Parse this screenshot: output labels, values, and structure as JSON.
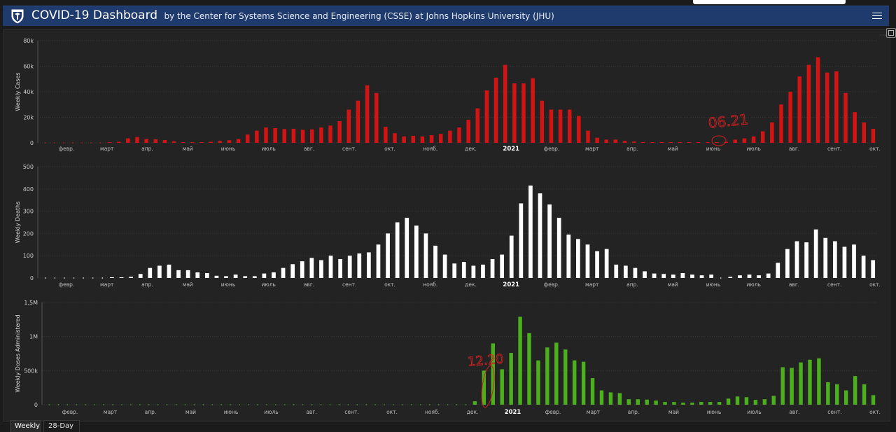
{
  "header": {
    "title": "COVID-19 Dashboard",
    "subtitle": "by the Center for Systems Science and Engineering (CSSE) at Johns Hopkins University (JHU)"
  },
  "tabs": [
    "Weekly",
    "28-Day"
  ],
  "colors": {
    "cases": "#d31414",
    "deaths": "#ffffff",
    "doses": "#4caf1d",
    "annotation": "#d32020"
  },
  "annotations": {
    "cases_note": "06.21",
    "doses_note": "12.20"
  },
  "chart_data": [
    {
      "type": "bar",
      "ylabel": "Weekly Cases",
      "ylim": [
        0,
        80000
      ],
      "yticks": [
        "0",
        "20k",
        "40k",
        "60k",
        "80k"
      ],
      "xticks": [
        "февр.",
        "март",
        "апр.",
        "май",
        "июнь",
        "июль",
        "авг.",
        "сент.",
        "окт.",
        "нояб.",
        "дек.",
        "2021",
        "февр.",
        "март",
        "апр.",
        "май",
        "июнь",
        "июль",
        "авг.",
        "сент.",
        "окт."
      ],
      "values": [
        0,
        0,
        0,
        0,
        0,
        0,
        0,
        200,
        800,
        3500,
        4500,
        3000,
        2800,
        2200,
        1200,
        500,
        200,
        300,
        800,
        1500,
        2000,
        3000,
        6500,
        9500,
        12000,
        11500,
        10800,
        11000,
        10200,
        10500,
        12000,
        13500,
        17000,
        26000,
        33000,
        45000,
        39000,
        12500,
        7500,
        5000,
        5500,
        5000,
        6000,
        7000,
        9500,
        12000,
        18000,
        27000,
        41000,
        51000,
        61000,
        46500,
        46500,
        50500,
        33000,
        26000,
        26000,
        26000,
        21000,
        9500,
        4000,
        2500,
        2500,
        1500,
        1000,
        600,
        500,
        600,
        400,
        300,
        300,
        200,
        100,
        200,
        800,
        2500,
        3500,
        5000,
        9000,
        16000,
        30000,
        40000,
        52000,
        61000,
        67000,
        55000,
        56000,
        39000,
        24000,
        16000,
        11000
      ]
    },
    {
      "type": "bar",
      "ylabel": "Weekly Deaths",
      "ylim": [
        0,
        500
      ],
      "yticks": [
        "0",
        "100",
        "200",
        "300",
        "400",
        "500"
      ],
      "xticks": [
        "февр.",
        "март",
        "апр.",
        "май",
        "июнь",
        "июль",
        "авг.",
        "сент.",
        "окт.",
        "нояб.",
        "дек.",
        "2021",
        "февр.",
        "март",
        "апр.",
        "май",
        "июнь",
        "июль",
        "авг.",
        "сент.",
        "окт."
      ],
      "values": [
        0,
        0,
        0,
        0,
        0,
        0,
        0,
        2,
        3,
        5,
        18,
        45,
        55,
        60,
        35,
        35,
        25,
        22,
        10,
        8,
        15,
        8,
        8,
        20,
        25,
        45,
        62,
        75,
        90,
        80,
        100,
        85,
        100,
        110,
        115,
        150,
        200,
        250,
        270,
        235,
        200,
        145,
        105,
        65,
        72,
        55,
        60,
        85,
        105,
        190,
        335,
        415,
        380,
        330,
        270,
        195,
        175,
        150,
        120,
        130,
        60,
        55,
        45,
        30,
        20,
        18,
        15,
        22,
        15,
        12,
        15,
        0,
        5,
        12,
        15,
        12,
        20,
        68,
        130,
        165,
        160,
        218,
        180,
        165,
        140,
        150,
        100,
        80
      ]
    },
    {
      "type": "bar",
      "ylabel": "Weekly Doses Administered",
      "ylim": [
        0,
        1500000
      ],
      "yticks": [
        "0",
        "500k",
        "1M",
        "1,5M"
      ],
      "xticks": [
        "февр.",
        "март",
        "апр.",
        "май",
        "июнь",
        "июль",
        "авг.",
        "сент.",
        "окт.",
        "нояб.",
        "дек.",
        "2021",
        "февр.",
        "март",
        "апр.",
        "май",
        "июнь",
        "июль",
        "авг.",
        "сент.",
        "окт."
      ],
      "values": [
        0,
        0,
        0,
        0,
        0,
        0,
        0,
        0,
        0,
        0,
        0,
        0,
        0,
        0,
        0,
        0,
        0,
        0,
        0,
        0,
        0,
        0,
        0,
        0,
        0,
        0,
        0,
        0,
        0,
        0,
        0,
        0,
        0,
        0,
        0,
        0,
        0,
        0,
        0,
        0,
        0,
        0,
        0,
        0,
        0,
        0,
        0,
        50000,
        500000,
        900000,
        520000,
        760000,
        1290000,
        1050000,
        650000,
        840000,
        910000,
        810000,
        650000,
        630000,
        390000,
        210000,
        180000,
        170000,
        80000,
        80000,
        75000,
        60000,
        40000,
        40000,
        30000,
        30000,
        40000,
        40000,
        40000,
        90000,
        120000,
        110000,
        70000,
        80000,
        130000,
        550000,
        540000,
        620000,
        660000,
        680000,
        330000,
        300000,
        210000,
        420000,
        300000,
        140000
      ]
    }
  ]
}
